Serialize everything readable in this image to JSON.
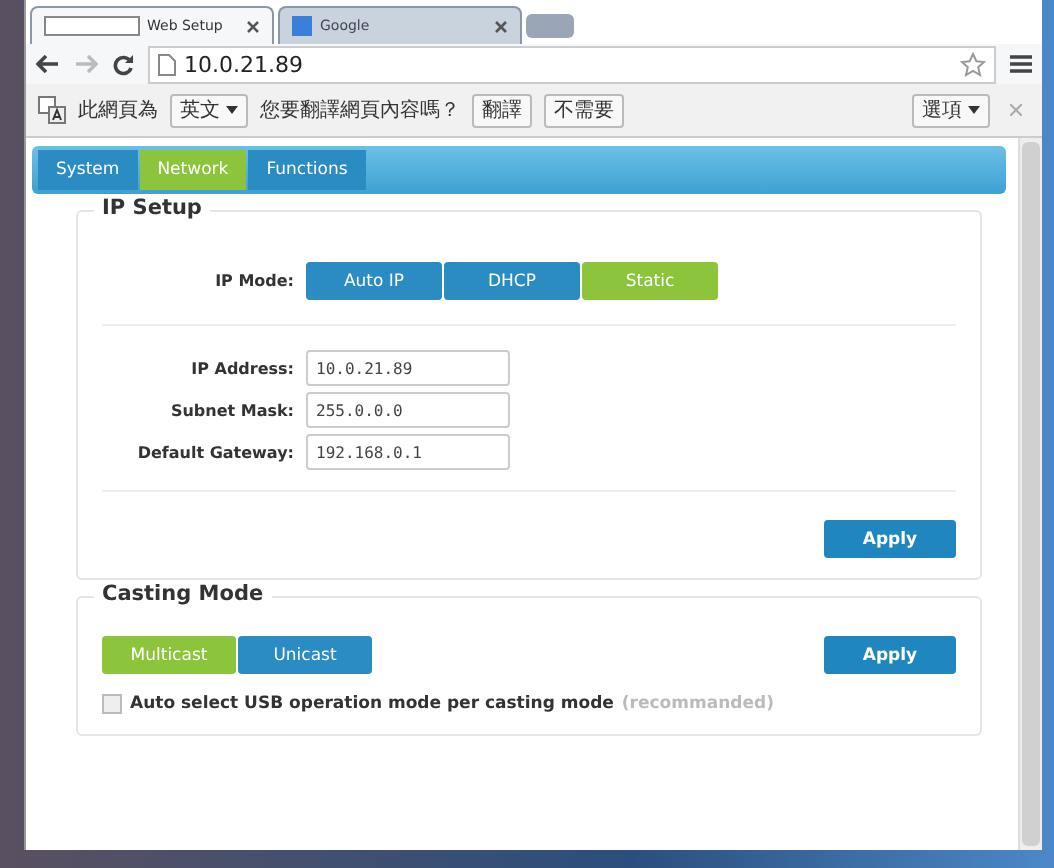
{
  "browser": {
    "tabs": [
      {
        "title": "Web Setup",
        "selected": true
      },
      {
        "title": "Google",
        "selected": false
      }
    ],
    "address": "10.0.21.89"
  },
  "translate_bar": {
    "prefix": "此網頁為",
    "language": "英文",
    "question": "您要翻譯網頁內容嗎？",
    "buttons": [
      "翻譯",
      "不需要"
    ],
    "options": "選項"
  },
  "nav_tabs": [
    {
      "label": "System",
      "selected": false
    },
    {
      "label": "Network",
      "selected": true
    },
    {
      "label": "Functions",
      "selected": false
    }
  ],
  "ip_setup": {
    "title": "IP Setup",
    "mode_label": "IP Mode:",
    "modes": [
      {
        "label": "Auto IP",
        "selected": false
      },
      {
        "label": "DHCP",
        "selected": false
      },
      {
        "label": "Static",
        "selected": true
      }
    ],
    "fields": [
      {
        "label": "IP Address:",
        "value": "10.0.21.89"
      },
      {
        "label": "Subnet Mask:",
        "value": "255.0.0.0"
      },
      {
        "label": "Default Gateway:",
        "value": "192.168.0.1"
      }
    ],
    "apply": "Apply"
  },
  "casting_mode": {
    "title": "Casting Mode",
    "modes": [
      {
        "label": "Multicast",
        "selected": true
      },
      {
        "label": "Unicast",
        "selected": false
      }
    ],
    "apply": "Apply",
    "auto_select": {
      "label": "Auto select USB operation mode per casting mode",
      "note": "(recommanded)",
      "checked": false
    }
  }
}
